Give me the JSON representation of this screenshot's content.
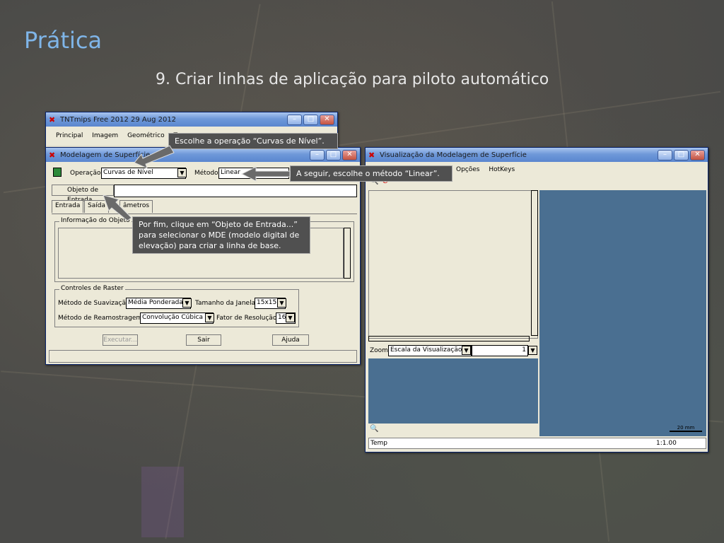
{
  "slide": {
    "title": "Prática",
    "subtitle": "9. Criar linhas de aplicação para piloto automático"
  },
  "main_window": {
    "title": "TNTmips Free 2012   29 Aug 2012",
    "menu": [
      "Principal",
      "Imagem",
      "Geométrico",
      "T"
    ]
  },
  "surface_window": {
    "title": "Modelagem de Superfície",
    "operation_label": "Operação",
    "operation_value": "Curvas de Nível",
    "method_label": "Método",
    "method_value": "Linear",
    "input_button": "Objeto de Entrada...",
    "tabs": [
      "Entrada",
      "Saída",
      "âmetros"
    ],
    "info_group": "Informação do Objeto",
    "raster_group": "Controles de Raster",
    "smoothing_label": "Método de Suavização",
    "smoothing_value": "Média Ponderada",
    "window_size_label": "Tamanho da Janela",
    "window_size_value": "15x15",
    "resample_label": "Método de Reamostragem",
    "resample_value": "Convolução Cúbica",
    "resolution_label": "Fator de Resolução",
    "resolution_value": "16",
    "execute_button": "Executar...",
    "exit_button": "Sair",
    "help_button": "Ajuda"
  },
  "view_window": {
    "title": "Visualização da Modelagem de Superfície",
    "menu": [
      "Opções",
      "HotKeys"
    ],
    "zoom_label": "Zoom",
    "zoom_value": "Escala da Visualização",
    "zoom_number": "1",
    "status_left": "Temp",
    "scale": "1:1.00",
    "scalebar": "20 mm"
  },
  "callouts": {
    "curvas": "Escolhe a operação “Curvas de Nível”.",
    "linear": "A seguir, escolhe o método “Linear”.",
    "objeto": "Por fim, clique em “Objeto de Entrada...” para selecionar  o MDE (modelo digital de elevação) para criar a linha de base."
  },
  "colors": {
    "title": "#7fb5e8",
    "view_canvas": "#4a6f91",
    "callout_bg": "#505050"
  }
}
